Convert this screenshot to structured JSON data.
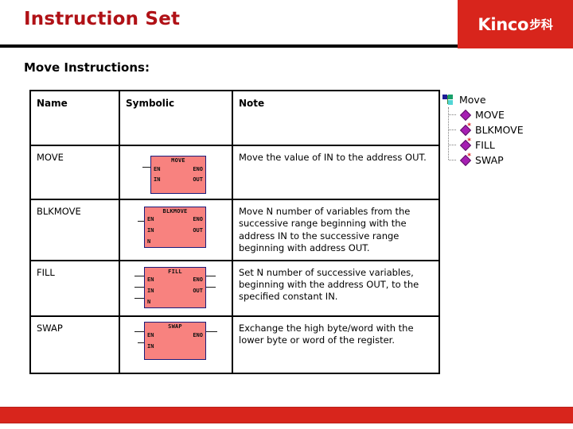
{
  "header": {
    "title": "Instruction Set",
    "logo_text": "Kinco",
    "logo_text_cn": "步科",
    "brand_red": "#d8251c",
    "title_red": "#b01116"
  },
  "subtitle": "Move Instructions:",
  "table": {
    "columns": [
      "Name",
      "Symbolic",
      "Note"
    ],
    "rows": [
      {
        "name": "MOVE",
        "note": "Move the value of IN to the address OUT.",
        "symbol": {
          "block_label": "MOVE",
          "pins_left": [
            "EN",
            "IN"
          ],
          "pins_right": [
            "ENO",
            "OUT"
          ]
        }
      },
      {
        "name": "BLKMOVE",
        "note": "Move N number of variables from the successive range beginning with the address IN to the successive range beginning with address OUT.",
        "symbol": {
          "block_label": "BLKMOVE",
          "pins_left": [
            "EN",
            "IN",
            "N"
          ],
          "pins_right": [
            "ENO",
            "OUT"
          ]
        }
      },
      {
        "name": "FILL",
        "note": "Set N number of successive variables, beginning with the address OUT, to the specified constant IN.",
        "symbol": {
          "block_label": "FILL",
          "pins_left": [
            "EN",
            "IN",
            "N"
          ],
          "pins_right": [
            "ENO",
            "OUT"
          ]
        }
      },
      {
        "name": "SWAP",
        "note": "Exchange the high byte/word with the lower byte or word of the register.",
        "symbol": {
          "block_label": "SWAP",
          "pins_left": [
            "EN",
            "IN"
          ],
          "pins_right": [
            "ENO"
          ]
        }
      }
    ]
  },
  "tree": {
    "root": {
      "label": "Move",
      "icon": "folder-icon"
    },
    "items": [
      {
        "label": "MOVE",
        "icon": "diamond-icon",
        "starred": false
      },
      {
        "label": "BLKMOVE",
        "icon": "diamond-star-icon",
        "starred": true
      },
      {
        "label": "FILL",
        "icon": "diamond-star-icon",
        "starred": true
      },
      {
        "label": "SWAP",
        "icon": "diamond-star-icon",
        "starred": true
      }
    ]
  },
  "footer": {
    "accent_color": "#d8251c"
  }
}
